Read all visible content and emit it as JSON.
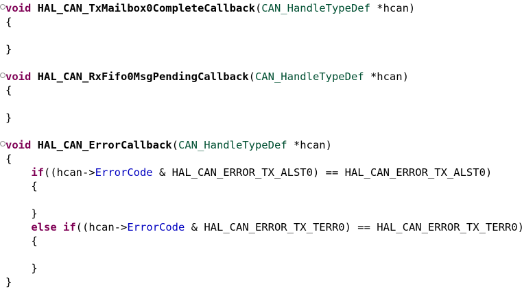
{
  "colors": {
    "keyword": "#7f0055",
    "type": "#005032",
    "field": "#0000c0",
    "text": "#000000",
    "background": "#ffffff"
  },
  "fold_marker": "⊖",
  "lines": [
    {
      "fold": true,
      "tokens": [
        {
          "t": "kw",
          "v": "void"
        },
        {
          "t": "plain",
          "v": " "
        },
        {
          "t": "fn",
          "v": "HAL_CAN_TxMailbox0CompleteCallback"
        },
        {
          "t": "plain",
          "v": "("
        },
        {
          "t": "ty",
          "v": "CAN_HandleTypeDef"
        },
        {
          "t": "plain",
          "v": " *hcan)"
        }
      ]
    },
    {
      "tokens": [
        {
          "t": "plain",
          "v": "{"
        }
      ]
    },
    {
      "tokens": []
    },
    {
      "tokens": [
        {
          "t": "plain",
          "v": "}"
        }
      ]
    },
    {
      "tokens": []
    },
    {
      "fold": true,
      "tokens": [
        {
          "t": "kw",
          "v": "void"
        },
        {
          "t": "plain",
          "v": " "
        },
        {
          "t": "fn",
          "v": "HAL_CAN_RxFifo0MsgPendingCallback"
        },
        {
          "t": "plain",
          "v": "("
        },
        {
          "t": "ty",
          "v": "CAN_HandleTypeDef"
        },
        {
          "t": "plain",
          "v": " *hcan)"
        }
      ]
    },
    {
      "tokens": [
        {
          "t": "plain",
          "v": "{"
        }
      ]
    },
    {
      "tokens": []
    },
    {
      "tokens": [
        {
          "t": "plain",
          "v": "}"
        }
      ]
    },
    {
      "tokens": []
    },
    {
      "fold": true,
      "tokens": [
        {
          "t": "kw",
          "v": "void"
        },
        {
          "t": "plain",
          "v": " "
        },
        {
          "t": "fn",
          "v": "HAL_CAN_ErrorCallback"
        },
        {
          "t": "plain",
          "v": "("
        },
        {
          "t": "ty",
          "v": "CAN_HandleTypeDef"
        },
        {
          "t": "plain",
          "v": " *hcan)"
        }
      ]
    },
    {
      "tokens": [
        {
          "t": "plain",
          "v": "{"
        }
      ]
    },
    {
      "tokens": [
        {
          "t": "plain",
          "v": "    "
        },
        {
          "t": "kw",
          "v": "if"
        },
        {
          "t": "plain",
          "v": "((hcan->"
        },
        {
          "t": "fld",
          "v": "ErrorCode"
        },
        {
          "t": "plain",
          "v": " & HAL_CAN_ERROR_TX_ALST0) == HAL_CAN_ERROR_TX_ALST0)"
        }
      ]
    },
    {
      "tokens": [
        {
          "t": "plain",
          "v": "    {"
        }
      ]
    },
    {
      "tokens": []
    },
    {
      "tokens": [
        {
          "t": "plain",
          "v": "    }"
        }
      ]
    },
    {
      "tokens": [
        {
          "t": "plain",
          "v": "    "
        },
        {
          "t": "kw",
          "v": "else"
        },
        {
          "t": "plain",
          "v": " "
        },
        {
          "t": "kw",
          "v": "if"
        },
        {
          "t": "plain",
          "v": "((hcan->"
        },
        {
          "t": "fld",
          "v": "ErrorCode"
        },
        {
          "t": "plain",
          "v": " & HAL_CAN_ERROR_TX_TERR0) == HAL_CAN_ERROR_TX_TERR0)"
        }
      ]
    },
    {
      "tokens": [
        {
          "t": "plain",
          "v": "    {"
        }
      ]
    },
    {
      "tokens": []
    },
    {
      "tokens": [
        {
          "t": "plain",
          "v": "    }"
        }
      ]
    },
    {
      "tokens": [
        {
          "t": "plain",
          "v": "}"
        }
      ]
    }
  ]
}
